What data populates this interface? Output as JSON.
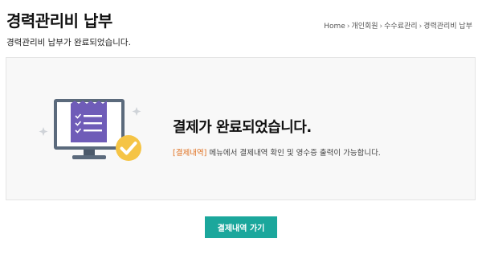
{
  "header": {
    "title": "경력관리비 납부",
    "subtitle": "경력관리비 납부가 완료되었습니다."
  },
  "breadcrumb": {
    "items": [
      "Home",
      "개인회원",
      "수수료관리",
      "경력관리비 납부"
    ]
  },
  "result": {
    "title": "결제가 완료되었습니다.",
    "highlight": "[결제내역]",
    "description": "메뉴에서 결제내역 확인 및 영수증 출력이 가능합니다."
  },
  "actions": {
    "primary_label": "결제내역 가기"
  },
  "colors": {
    "accent": "#1ba79c",
    "highlight": "#e0701f",
    "monitor": "#5b6a7c",
    "receipt": "#6f5cb8",
    "check": "#f5c445"
  },
  "icons": {
    "illustration": "monitor-receipt-check-icon"
  }
}
